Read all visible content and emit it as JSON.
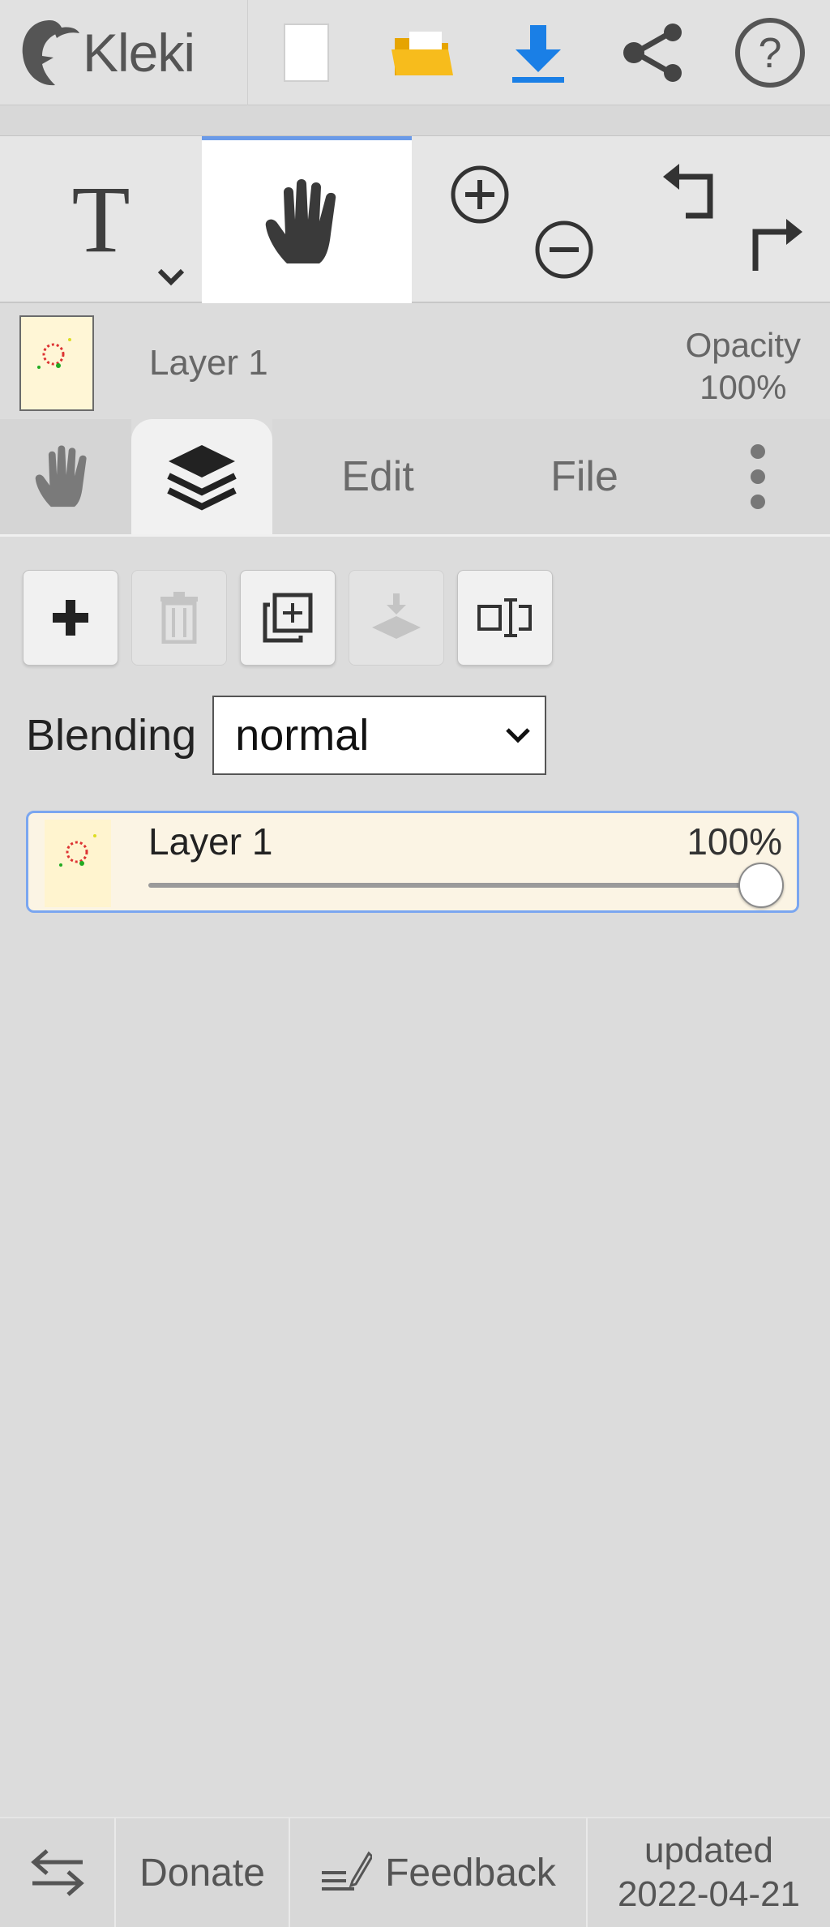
{
  "app": {
    "name": "Kleki"
  },
  "topbar": {
    "icons": [
      "kleki-logo-icon",
      "new-file-icon",
      "open-folder-icon",
      "download-icon",
      "share-icon",
      "help-icon"
    ]
  },
  "tools": {
    "text_icon": "T",
    "active": "hand"
  },
  "layer_header": {
    "name": "Layer 1",
    "opacity_label": "Opacity",
    "opacity_value": "100%"
  },
  "tabs": {
    "edit": "Edit",
    "file": "File",
    "active": "layers"
  },
  "layers_panel": {
    "blending_label": "Blending",
    "blending_value": "normal",
    "layers": [
      {
        "name": "Layer 1",
        "opacity": "100%",
        "opacity_fraction": 1.0,
        "selected": true
      }
    ]
  },
  "footer": {
    "donate": "Donate",
    "feedback": "Feedback",
    "updated_label": "updated",
    "updated_date": "2022-04-21"
  },
  "colors": {
    "accent": "#6a9ae8",
    "download_icon": "#1a7fe6",
    "folder_icon": "#f5b400"
  }
}
